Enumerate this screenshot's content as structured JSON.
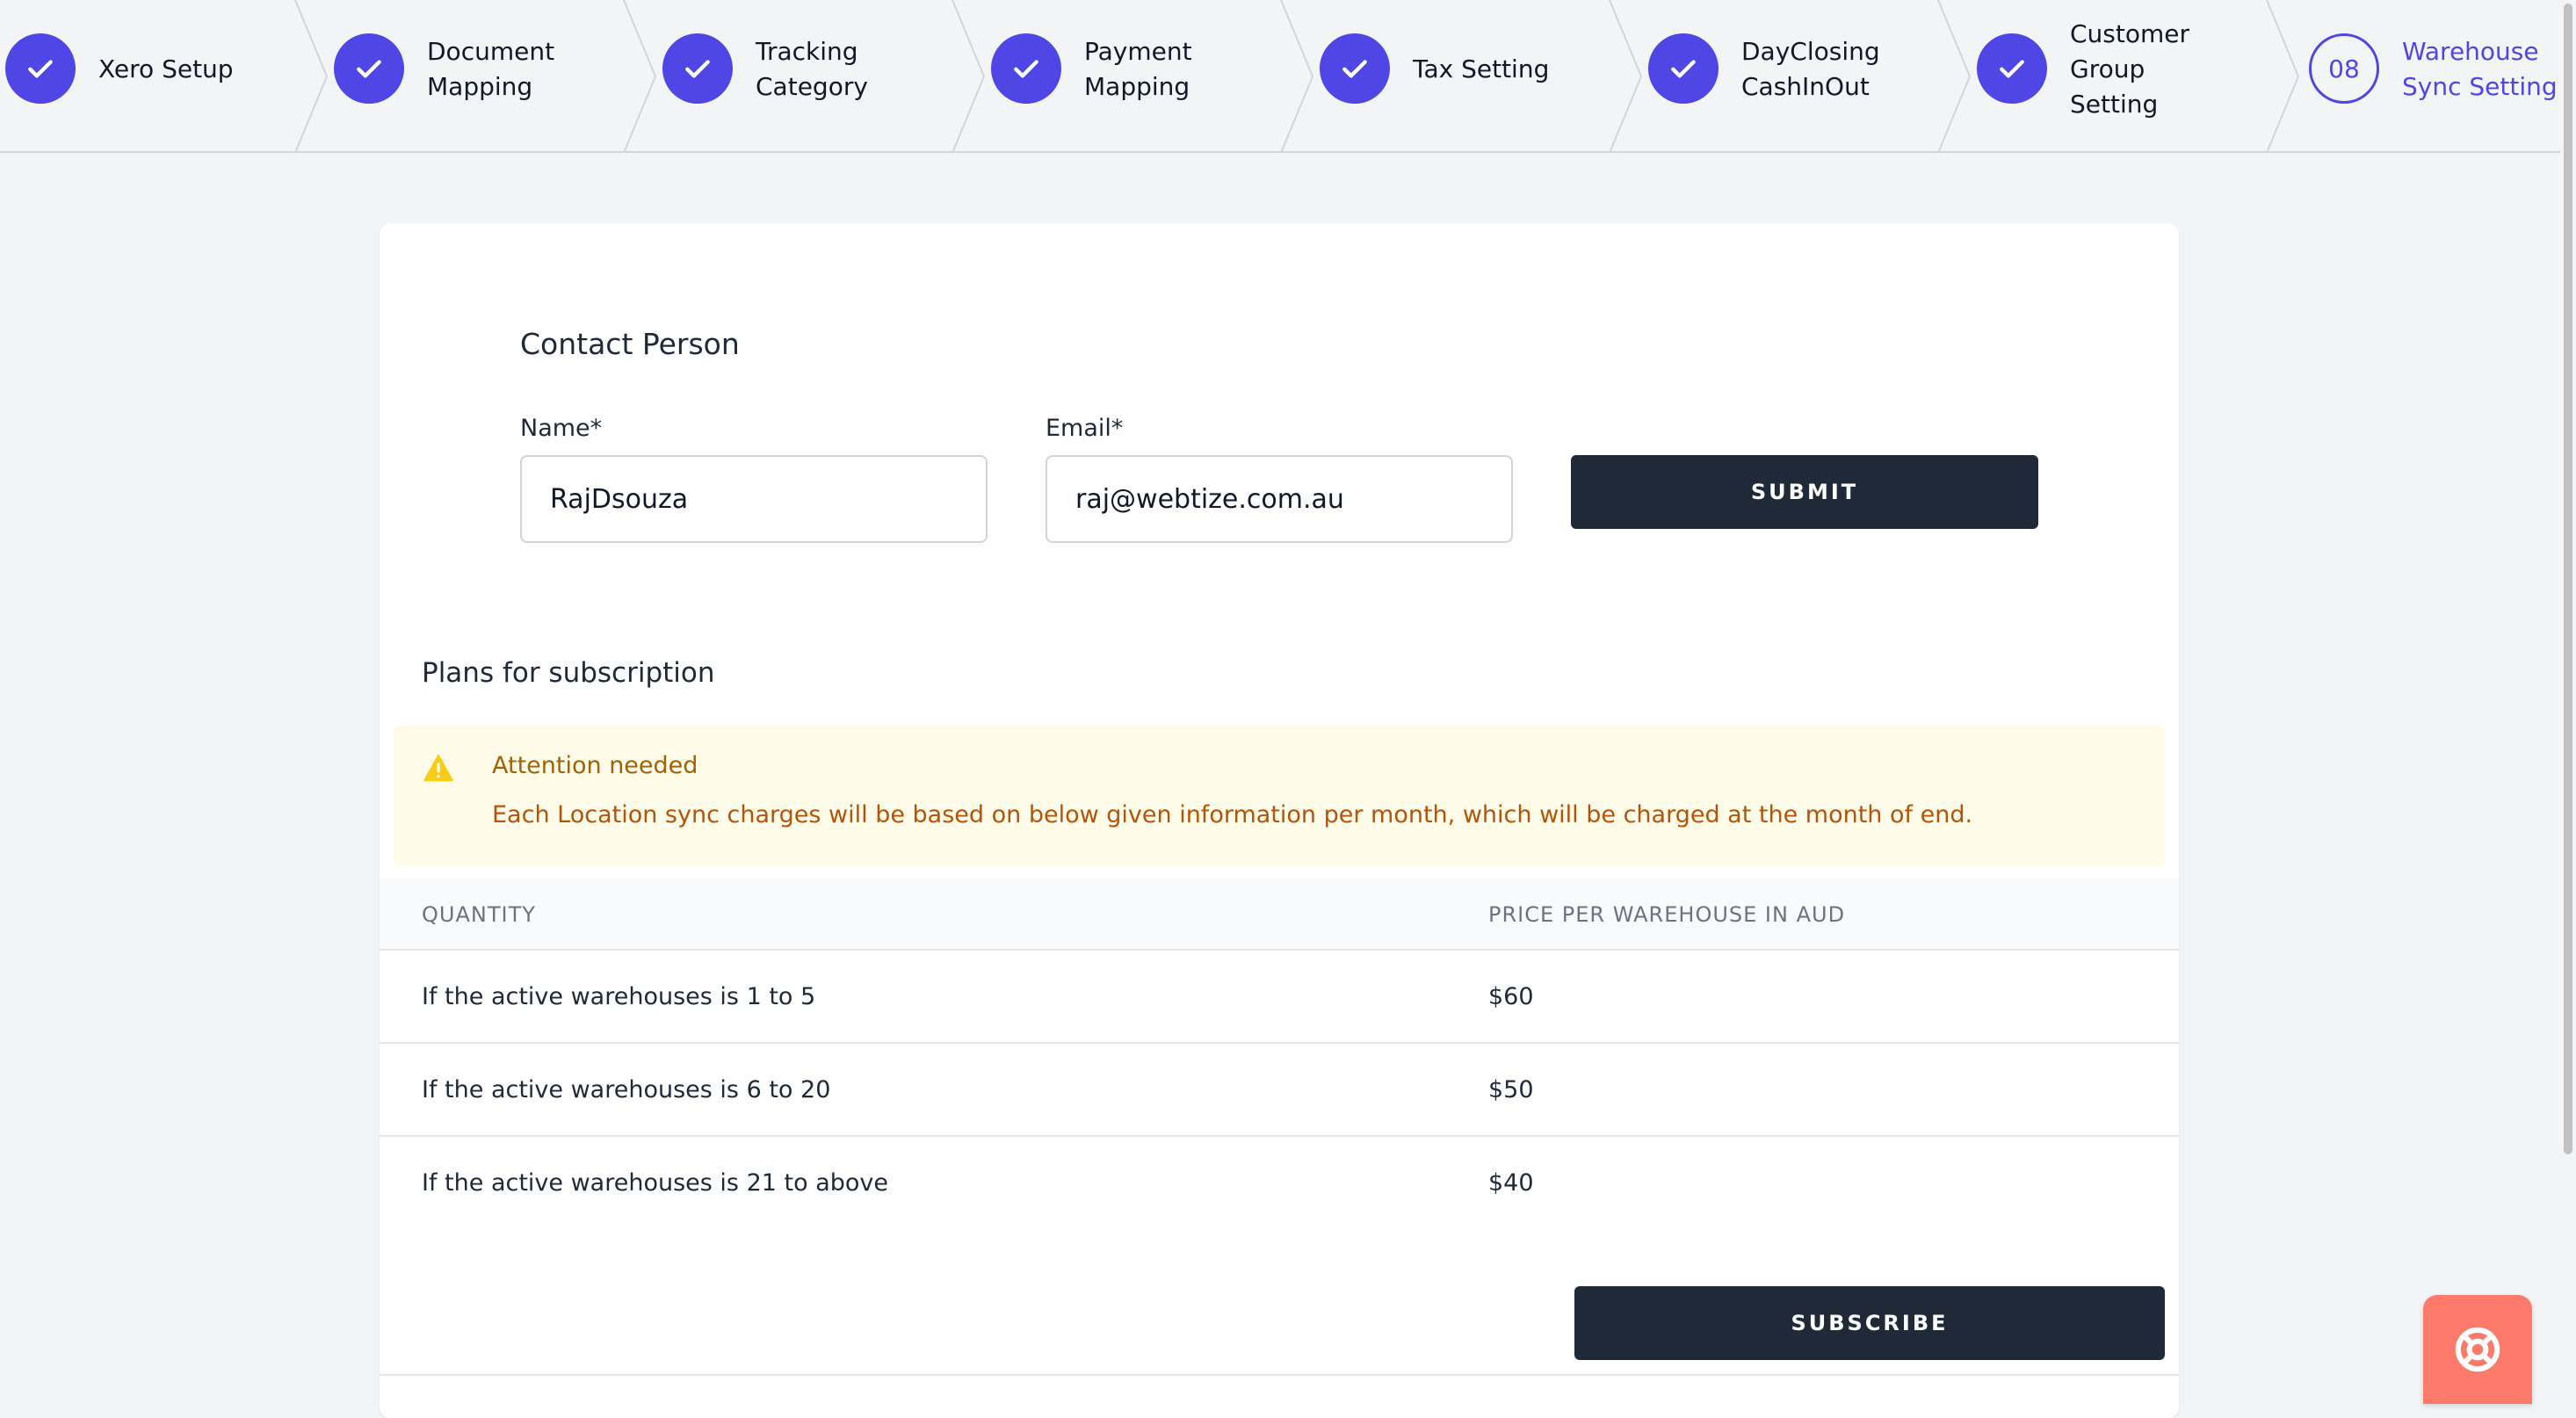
{
  "stepper": {
    "steps": [
      {
        "label": "Xero Setup",
        "status": "complete",
        "icon": "check-icon"
      },
      {
        "label": "Document\nMapping",
        "status": "complete",
        "icon": "check-icon"
      },
      {
        "label": "Tracking\nCategory",
        "status": "complete",
        "icon": "check-icon"
      },
      {
        "label": "Payment\nMapping",
        "status": "complete",
        "icon": "check-icon"
      },
      {
        "label": "Tax Setting",
        "status": "complete",
        "icon": "check-icon"
      },
      {
        "label": "DayClosing\nCashInOut",
        "status": "complete",
        "icon": "check-icon"
      },
      {
        "label": "Customer\nGroup\nSetting",
        "status": "complete",
        "icon": "check-icon"
      },
      {
        "label": "Warehouse\nSync Setting",
        "status": "current",
        "number": "08"
      }
    ]
  },
  "contact": {
    "title": "Contact Person",
    "name_label": "Name*",
    "name_value": "RajDsouza",
    "email_label": "Email*",
    "email_value": "raj@webtize.com.au",
    "submit_label": "SUBMIT"
  },
  "plans": {
    "title": "Plans for subscription",
    "alert": {
      "icon": "warning-triangle-icon",
      "title": "Attention needed",
      "text": "Each Location sync charges will be based on below given information per month, which will be charged at the month of end."
    },
    "table": {
      "headers": [
        "QUANTITY",
        "PRICE PER WAREHOUSE IN AUD"
      ],
      "rows": [
        [
          "If the active warehouses is 1 to 5",
          "$60"
        ],
        [
          "If the active warehouses is 6 to 20",
          "$50"
        ],
        [
          "If the active warehouses is 21 to above",
          "$40"
        ]
      ]
    },
    "subscribe_label": "SUBSCRIBE"
  },
  "help": {
    "icon": "lifebuoy-icon"
  },
  "colors": {
    "accent": "#4f46e5",
    "dark_button": "#1f2937",
    "alert_bg": "#fefce8",
    "alert_text": "#b45309",
    "help_button": "#fb7a6a"
  }
}
